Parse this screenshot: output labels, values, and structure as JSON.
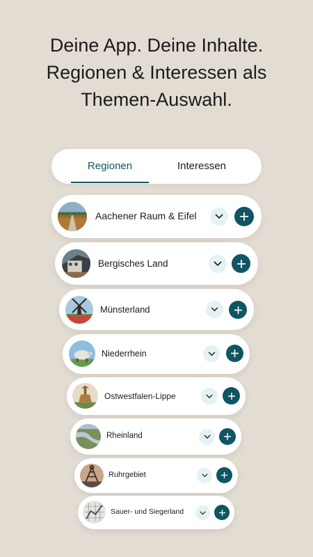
{
  "headline": {
    "line1": "Deine App. Deine Inhalte.",
    "line2": "Regionen & Interessen als",
    "line3": "Themen-Auswahl."
  },
  "tabs": [
    {
      "label": "Regionen",
      "active": true
    },
    {
      "label": "Interessen",
      "active": false
    }
  ],
  "regions": [
    {
      "name": "Aachener Raum & Eifel",
      "icon": "aachen-thumbnail"
    },
    {
      "name": "Bergisches Land",
      "icon": "bergisches-land-thumbnail"
    },
    {
      "name": "Münsterland",
      "icon": "muensterland-windmill-thumbnail"
    },
    {
      "name": "Niederrhein",
      "icon": "niederrhein-sheep-thumbnail"
    },
    {
      "name": "Ostwestfalen-Lippe",
      "icon": "owl-monument-thumbnail"
    },
    {
      "name": "Rheinland",
      "icon": "rheinland-river-thumbnail"
    },
    {
      "name": "Ruhrgebiet",
      "icon": "ruhrgebiet-headframe-thumbnail"
    },
    {
      "name": "Sauer- und Siegerland",
      "icon": "sauerland-map-thumbnail"
    }
  ],
  "colors": {
    "background": "#e2dcd2",
    "accent": "#0f5563",
    "chevron_bg": "#e4f2f4"
  }
}
